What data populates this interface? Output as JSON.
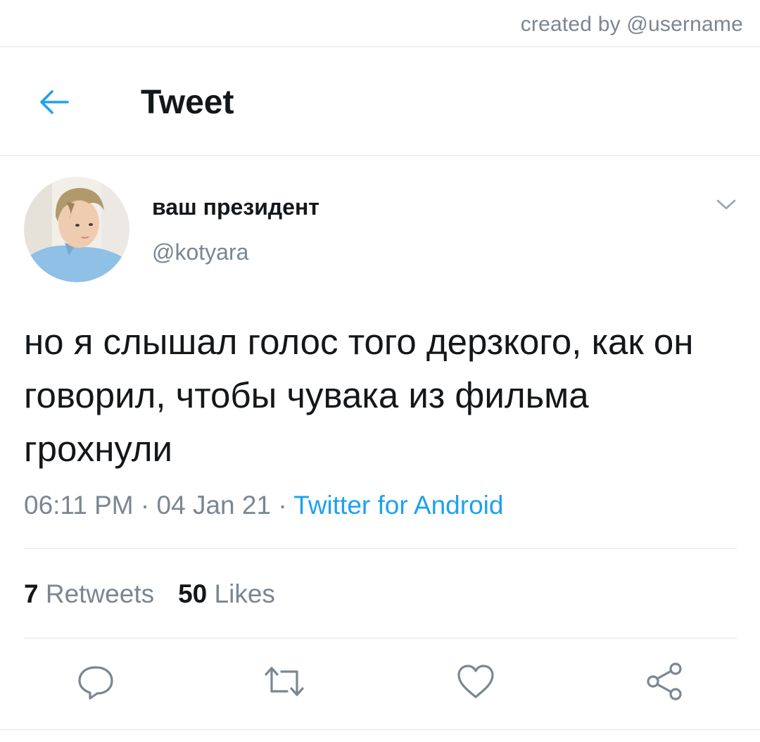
{
  "credit": "created by @username",
  "header": {
    "title": "Tweet",
    "back_icon": "arrow-left-icon"
  },
  "tweet": {
    "author_name": "ваш президент",
    "author_handle": "@kotyara",
    "text": "но я слышал голос того дерзкого, как он говорил, чтобы чувака из фильма грохнули",
    "time": "06:11 PM",
    "date": "04 Jan 21",
    "separator": " · ",
    "source": "Twitter for Android",
    "retweets_count": "7",
    "retweets_label": "Retweets",
    "likes_count": "50",
    "likes_label": "Likes"
  },
  "actions": [
    "reply-icon",
    "retweet-icon",
    "like-icon",
    "share-icon"
  ],
  "colors": {
    "accent": "#1da1f2",
    "text_primary": "#14171a",
    "text_secondary": "#7b8691",
    "divider": "#e3e7ea"
  }
}
